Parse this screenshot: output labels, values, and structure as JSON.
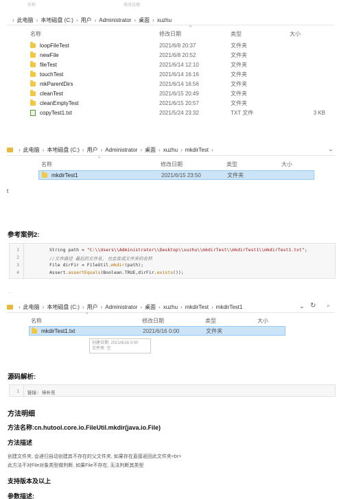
{
  "top_header": {
    "cols": [
      "名称",
      "修改日期",
      "类型",
      "大小"
    ]
  },
  "explorer1": {
    "breadcrumb": [
      "此电脑",
      "本地磁盘 (C:)",
      "用户",
      "Administrator",
      "桌面",
      "xuzhu"
    ],
    "columns": [
      "名称",
      "修改日期",
      "类型",
      "大小"
    ],
    "rows": [
      {
        "name": "loopFileTest",
        "date": "2021/6/8 20:37",
        "type": "文件夹",
        "size": ""
      },
      {
        "name": "newFile",
        "date": "2021/6/8 20:52",
        "type": "文件夹",
        "size": ""
      },
      {
        "name": "fileTest",
        "date": "2021/6/14 12:10",
        "type": "文件夹",
        "size": ""
      },
      {
        "name": "touchTest",
        "date": "2021/6/14 16:16",
        "type": "文件夹",
        "size": ""
      },
      {
        "name": "mkParentDirs",
        "date": "2021/6/14 16:56",
        "type": "文件夹",
        "size": ""
      },
      {
        "name": "cleanTest",
        "date": "2021/6/15 20:49",
        "type": "文件夹",
        "size": ""
      },
      {
        "name": "cleanEmptyTest",
        "date": "2021/6/15 20:57",
        "type": "文件夹",
        "size": ""
      },
      {
        "name": "copyTest1.txt",
        "date": "2021/5/24 23:32",
        "type": "TXT 文件",
        "size": "3 KB"
      }
    ]
  },
  "explorer2": {
    "breadcrumb": [
      "此电脑",
      "本地磁盘 (C:)",
      "用户",
      "Administrator",
      "桌面",
      "xuzhu",
      "mkdirTest"
    ],
    "columns": [
      "名称",
      "修改日期",
      "类型",
      "大小"
    ],
    "rows": [
      {
        "name": "mkdirTest1",
        "date": "2021/6/15 23:50",
        "type": "文件夹"
      }
    ]
  },
  "stray_char": "t",
  "section2_title": "参考案例2:",
  "code": {
    "line_numbers": [
      "1",
      "2",
      "3",
      "4"
    ],
    "l1_prefix": "String path = ",
    "l1_str": "\"C:\\\\Users\\\\Administrator\\\\Desktop\\\\xuzhu\\\\mkdirTest\\\\mkdirTest1\\\\mkdirTest1.txt\"",
    "l1_suffix": ";",
    "l2": "//文件路径 最后的文件名, 也会变成文件夹的名称",
    "l3_prefix": "File dirFir = FileUtil.",
    "l3_fn": "mkdir",
    "l3_suffix": "(path);",
    "l4_prefix": "Assert.",
    "l4_fn": "assertEquals",
    "l4_mid": "(Boolean.TRUE,dirFir.",
    "l4_fn2": "exists",
    "l4_suffix": "());"
  },
  "explorer3": {
    "breadcrumb": [
      "此电脑",
      "本地磁盘 (C:)",
      "用户",
      "Administrator",
      "桌面",
      "xuzhu",
      "mkdirTest",
      "mkdirTest1"
    ],
    "columns": [
      "名称",
      "修改日期",
      "类型",
      "大小"
    ],
    "rows": [
      {
        "name": "mkdirTest1.txt",
        "date": "2021/6/16 0:00",
        "type": "文件夹"
      }
    ],
    "tooltip_line1": "创建日期: 2021/6/16 0:00",
    "tooltip_line2": "文件夹: 空"
  },
  "source_title": "源码解析:",
  "source_code": {
    "ln": "1",
    "text": "链接: 待补充"
  },
  "method_detail_title": "方法明细",
  "method_name": "方法名称:cn.hutool.core.io.FileUtil.mkdir(java.io.File)",
  "method_desc_title": "方法描述",
  "method_desc_lines": [
    "创建文件夹, 会递归自动创建其不存在的父文件夹, 如果存在直接返回此文件夹<br>",
    "此方法不对File对象类型做判断, 如果File不存在, 无法判断其类型"
  ],
  "version_title": "支持版本及以上",
  "params_title": "参数描述:"
}
